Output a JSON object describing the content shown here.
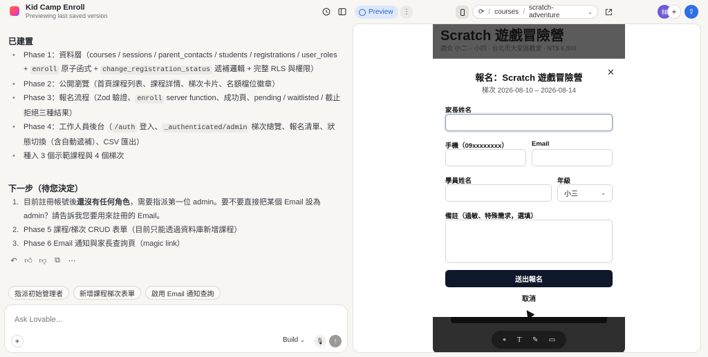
{
  "app": {
    "project_title": "Kid Camp Enroll",
    "project_subtitle": "Previewing last saved version",
    "preview_label": "Preview",
    "url_path_1": "courses",
    "url_path_2": "scratch-adventure",
    "avatar_initial": "林"
  },
  "chat": {
    "built_heading": "已建置",
    "phases": [
      {
        "pre": "Phase 1：資料層（courses / sessions / parent_contacts / students / registrations / user_roles + ",
        "code1": "enroll",
        "mid": " 原子函式 + ",
        "code2": "change_registration_status",
        "post": " 遞補邏輯 + 完整 RLS 與權限）"
      },
      {
        "text": "Phase 2：公開瀏覽（首頁課程列表、課程詳情、梯次卡片、名額檔位徽章）"
      },
      {
        "pre": "Phase 3：報名流程（Zod 驗證、",
        "code1": "enroll",
        "post": " server function、成功頁、pending / waitlisted / 截止拒絕三種結果）"
      },
      {
        "pre": "Phase 4：工作人員後台（",
        "code1": "/auth",
        "mid": " 登入、",
        "code2": "_authenticated/admin",
        "post": " 梯次總覽、報名清單、狀態切換（含自動遞補）、CSV 匯出）"
      },
      {
        "text": "種入 3 個示範課程與 4 個梯次"
      }
    ],
    "next_heading": "下一步（待您決定）",
    "next_items": [
      {
        "num": "1.",
        "pre": "目前註冊帳號後",
        "bold": "還沒有任何角色",
        "post": "，需要指派第一位 admin。要不要直接把某個 Email 設為 admin？請告訴我您要用來註冊的 Email。"
      },
      {
        "num": "2.",
        "text": "Phase 5 課程/梯次 CRUD 表單（目前只能透過資料庫新增課程）"
      },
      {
        "num": "3.",
        "text": "Phase 6 Email 通知與家長查詢頁（magic link）"
      }
    ],
    "suggestions": [
      "指派初始管理者",
      "新增課程梯次表單",
      "啟用 Email 通知查詢"
    ],
    "composer_placeholder": "Ask Lovable...",
    "mode_label": "Build"
  },
  "preview": {
    "bg_title": "Scratch 遊戲冒險營",
    "bg_subtitle": "適合 小二 – 小四 · 台北市大安區教室 · NT$ 6,800",
    "modal_title": "報名：Scratch 遊戲冒險營",
    "modal_subtitle": "梯次 2026-08-10 – 2026-08-14",
    "parent_name_label": "家長姓名",
    "phone_label": "手機（09xxxxxxxx）",
    "email_label": "Email",
    "student_name_label": "學員姓名",
    "grade_label": "年級",
    "grade_value": "小三",
    "notes_label": "備註（過敏、特殊需求，選填）",
    "submit_label": "送出報名",
    "cancel_label": "取消"
  }
}
